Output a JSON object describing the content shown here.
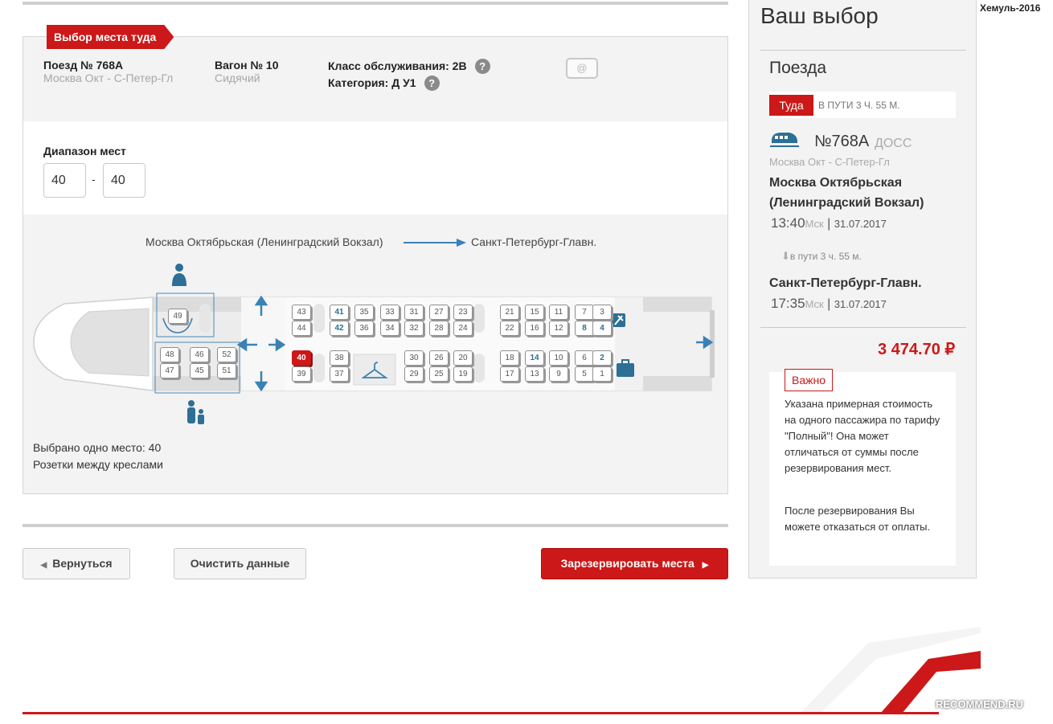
{
  "header": {
    "ribbon": "Выбор места туда",
    "train_label": "Поезд № 768А",
    "train_route": "Москва Окт - С-Петер-Гл",
    "car_label": "Вагон № 10",
    "car_type": "Сидячий",
    "service_class": "Класс обслуживания: 2В",
    "category": "Категория: Д У1",
    "qmark": "?",
    "ticket_icon": "@"
  },
  "range": {
    "label": "Диапазон мест",
    "from": "40",
    "to": "40",
    "separator": "-"
  },
  "route": {
    "from": "Москва Октябрьская (Ленинградский Вокзал)",
    "to": "Санкт-Петербург-Главн."
  },
  "seats": {
    "top_row_1": [
      "43",
      "41",
      "35",
      "33",
      "31",
      "27",
      "23",
      "21",
      "15",
      "11",
      "7",
      "3"
    ],
    "top_row_2": [
      "44",
      "42",
      "36",
      "34",
      "32",
      "28",
      "24",
      "22",
      "16",
      "12",
      "8",
      "4"
    ],
    "bottom_row_1": [
      "40",
      "38",
      "30",
      "26",
      "20",
      "18",
      "14",
      "10",
      "6",
      "2"
    ],
    "bottom_row_2": [
      "39",
      "37",
      "29",
      "25",
      "19",
      "17",
      "13",
      "9",
      "5",
      "1"
    ],
    "front_single": "49",
    "front_group_1": [
      "48",
      "46",
      "52"
    ],
    "front_group_2": [
      "47",
      "45",
      "51"
    ],
    "available": [
      "41",
      "42",
      "8",
      "4",
      "14",
      "2"
    ],
    "selected": "40"
  },
  "notes": {
    "selected": "Выбрано одно место: 40",
    "sockets": "Розетки между креслами"
  },
  "buttons": {
    "back": "Вернуться",
    "clear": "Очистить данные",
    "reserve": "Зарезервировать места"
  },
  "sidebar": {
    "title": "Ваш выбор",
    "subtitle": "Поезда",
    "direction_badge": "Туда",
    "travel_time": "В ПУТИ  3 Ч. 55 М.",
    "train_no": "№768А",
    "train_type": "ДОСС",
    "train_route": "Москва Окт - С-Петер-Гл",
    "dep_station": "Москва Октябрьская (Ленинградский Вокзал)",
    "dep_time": "13:40",
    "dep_tz": "Мск",
    "dep_date": "31.07.2017",
    "duration": "в пути  3 ч. 55 м.",
    "arr_station": "Санкт-Петербург-Главн.",
    "arr_time": "17:35",
    "arr_tz": "Мск",
    "arr_date": "31.07.2017",
    "price": "3 474.70 ₽",
    "warn_badge": "Важно",
    "warn_text_1": "Указана примерная стоимость на одного пассажира по тарифу \"Полный\"! Она может отличаться от суммы после резервирования мест.",
    "warn_text_2": "После резервирования Вы можете отказаться от оплаты."
  },
  "watermark": "Хемуль-2016",
  "recommend": "RECOMMEND.RU",
  "colors": {
    "accent": "#cc1818",
    "seat_available": "#2d6f95",
    "arrow": "#3a82b5"
  }
}
